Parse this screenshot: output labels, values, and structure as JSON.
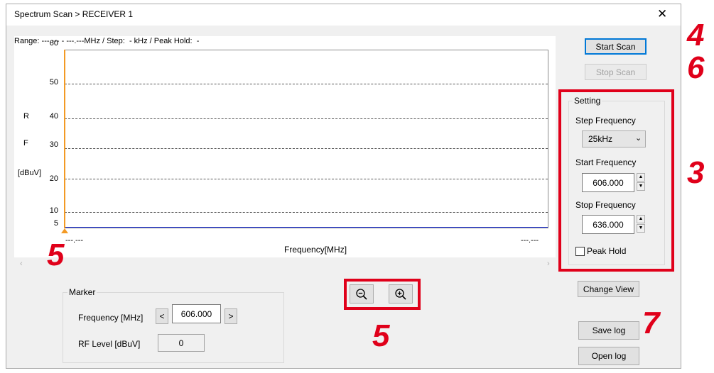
{
  "window": {
    "title": "Spectrum Scan > RECEIVER 1",
    "close_glyph": "✕"
  },
  "plot": {
    "range_info": "Range: ---.--- - ---.---MHz / Step:  - kHz / Peak Hold:  -",
    "y_ticks": [
      "60",
      "50",
      "40",
      "30",
      "20",
      "10",
      "5"
    ],
    "y_label_parts": [
      "R",
      "F",
      "[dBuV]"
    ],
    "x_min_label": "---.---",
    "x_max_label": "---.---",
    "x_label": "Frequency[MHz]"
  },
  "buttons": {
    "start_scan": "Start Scan",
    "stop_scan": "Stop Scan",
    "change_view": "Change View",
    "save_log": "Save log",
    "open_log": "Open log"
  },
  "setting": {
    "group_label": "Setting",
    "step_frequency_label": "Step Frequency",
    "step_frequency_value": "25kHz",
    "start_frequency_label": "Start Frequency",
    "start_frequency_value": "606.000",
    "stop_frequency_label": "Stop Frequency",
    "stop_frequency_value": "636.000",
    "peak_hold_label": "Peak Hold"
  },
  "marker": {
    "group_label": "Marker",
    "frequency_label": "Frequency [MHz]",
    "frequency_value": "606.000",
    "prev_label": "<",
    "next_label": ">",
    "rf_level_label": "RF Level [dBuV]",
    "rf_level_value": "0"
  },
  "callouts": {
    "c4": "4",
    "c6": "6",
    "c3": "3",
    "c5a": "5",
    "c5b": "5",
    "c7": "7"
  },
  "colors": {
    "callout_red": "#e0001a",
    "marker_orange": "#f39a24",
    "trace_blue": "#1c2fd6"
  }
}
